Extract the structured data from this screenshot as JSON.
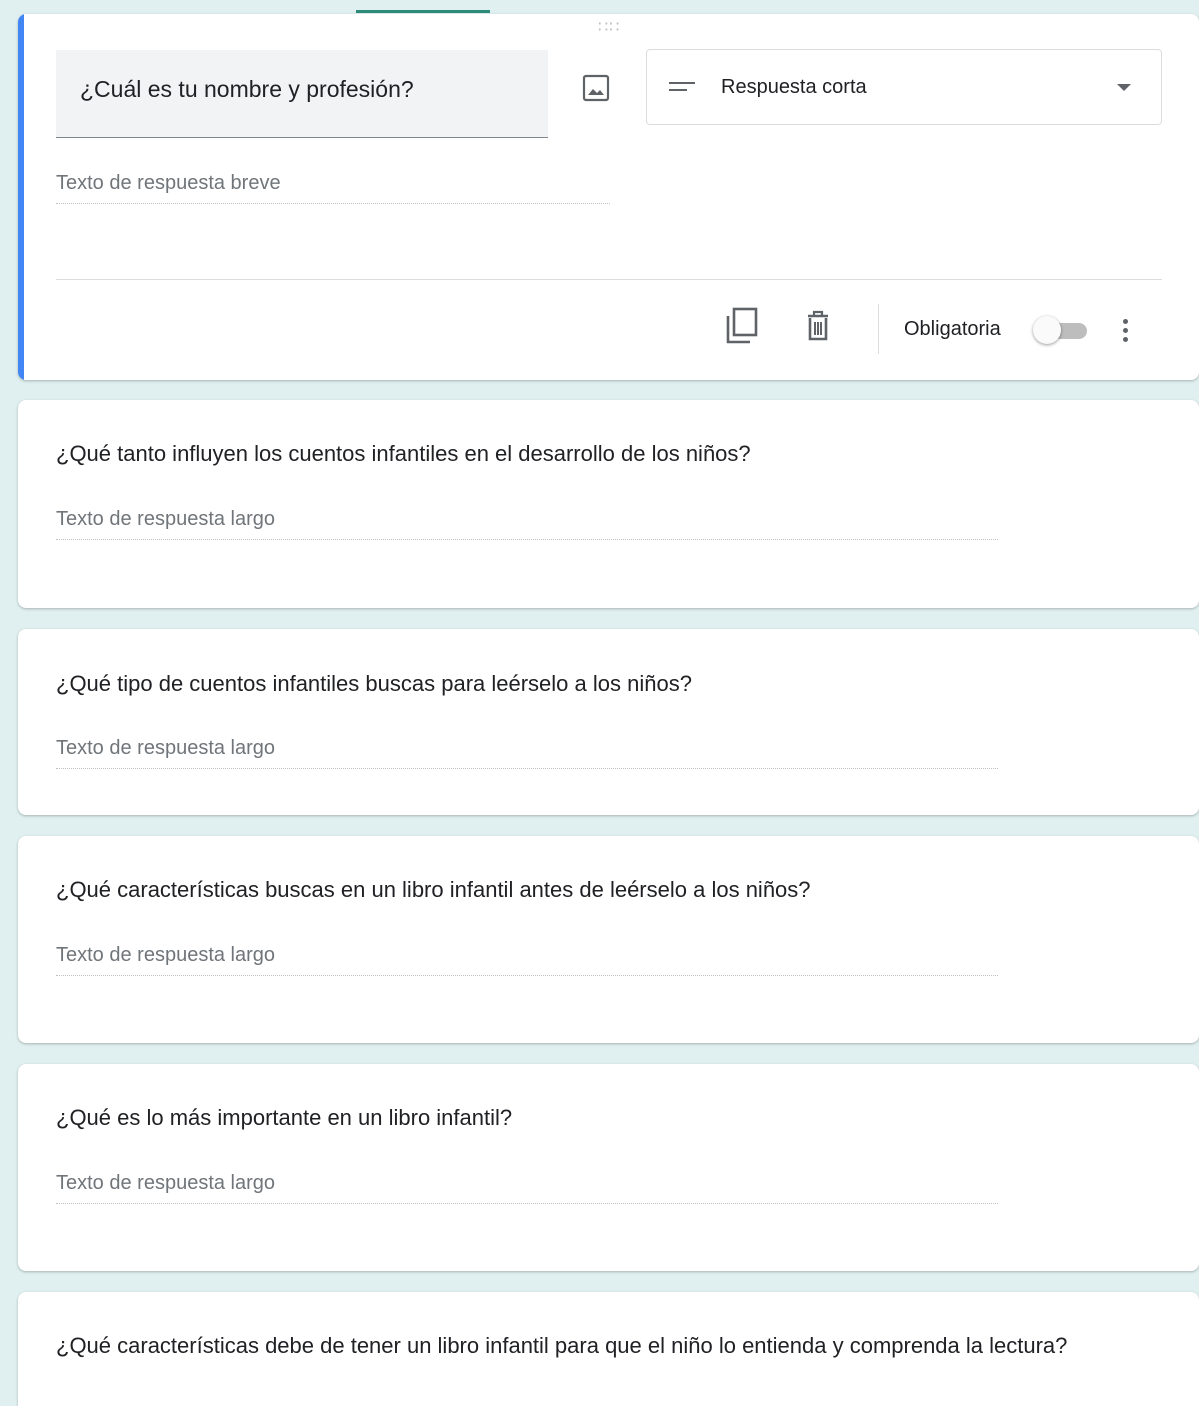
{
  "active_question": {
    "title": "¿Cuál es tu nombre y profesión?",
    "type_select": {
      "icon": "short-answer-icon",
      "label": "Respuesta corta"
    },
    "answer_placeholder": "Texto de respuesta breve",
    "required_label": "Obligatoria",
    "required": false,
    "accent_color": "#4285f4"
  },
  "questions": [
    {
      "title": "¿Qué tanto influyen los cuentos infantiles en el desarrollo de los niños?",
      "answer_placeholder": "Texto de respuesta largo"
    },
    {
      "title": "¿Qué tipo de cuentos infantiles buscas para leérselo a los niños?",
      "answer_placeholder": "Texto de respuesta largo"
    },
    {
      "title": "¿Qué características buscas en un libro infantil antes de leérselo a los niños?",
      "answer_placeholder": "Texto de respuesta largo"
    },
    {
      "title": "¿Qué es lo más importante en un libro infantil?",
      "answer_placeholder": "Texto de respuesta largo"
    },
    {
      "title": "¿Qué características debe de tener un libro infantil para que el niño lo entienda y comprenda la lectura?"
    }
  ]
}
